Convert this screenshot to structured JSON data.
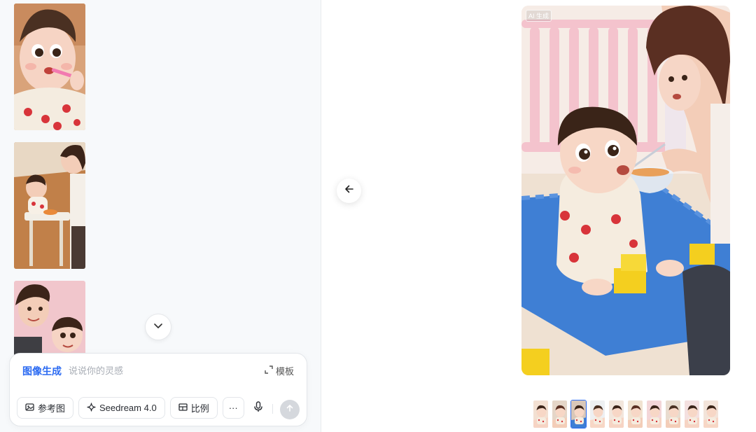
{
  "history": {
    "items": [
      {
        "label": "feeding-closeup"
      },
      {
        "label": "highchair-feeding"
      },
      {
        "label": "mother-and-baby"
      }
    ]
  },
  "composer": {
    "mode_label": "图像生成",
    "prompt_placeholder": "说说你的灵感",
    "template_label": "模板",
    "reference_label": "参考图",
    "model_label": "Seedream 4.0",
    "ratio_label": "比例",
    "more_label": "···"
  },
  "viewer": {
    "ai_badge": "AI 生成",
    "filmstrip_count": 10,
    "active_index": 2
  },
  "colors": {
    "accent": "#2c6bf2",
    "send_disabled": "#d5d8dd"
  }
}
